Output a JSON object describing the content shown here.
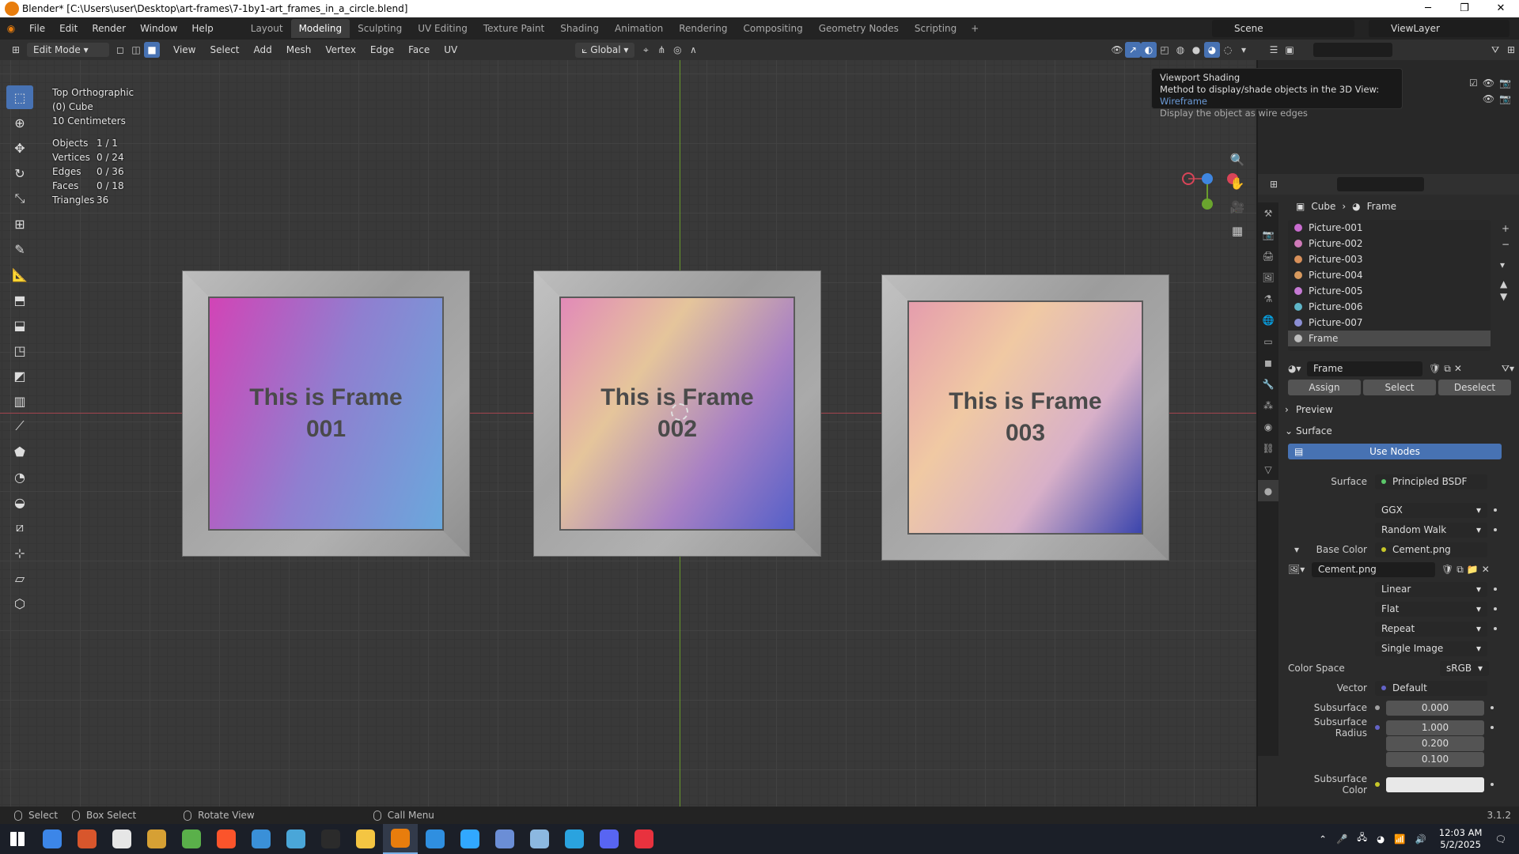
{
  "window": {
    "title": "Blender* [C:\\Users\\user\\Desktop\\art-frames\\7-1by1-art_frames_in_a_circle.blend]"
  },
  "menus": [
    "File",
    "Edit",
    "Render",
    "Window",
    "Help"
  ],
  "workspaces": [
    "Layout",
    "Modeling",
    "Sculpting",
    "UV Editing",
    "Texture Paint",
    "Shading",
    "Animation",
    "Rendering",
    "Compositing",
    "Geometry Nodes",
    "Scripting"
  ],
  "active_workspace": "Modeling",
  "scene": "Scene",
  "view_layer": "ViewLayer",
  "header3d": {
    "mode": "Edit Mode",
    "menus": [
      "View",
      "Select",
      "Add",
      "Mesh",
      "Vertex",
      "Edge",
      "Face",
      "UV"
    ],
    "orientation": "Global"
  },
  "viewport": {
    "view_name": "Top Orthographic",
    "object": "(0) Cube",
    "scale": "10 Centimeters",
    "stats": [
      {
        "k": "Objects",
        "v": "1 / 1"
      },
      {
        "k": "Vertices",
        "v": "0 / 24"
      },
      {
        "k": "Edges",
        "v": "0 / 36"
      },
      {
        "k": "Faces",
        "v": "0 / 18"
      },
      {
        "k": "Triangles",
        "v": "36"
      }
    ],
    "frames": [
      {
        "label": "This is Frame\n001",
        "gradient": [
          "#d244b6",
          "#8f7fd0",
          "#6aa8dc"
        ]
      },
      {
        "label": "This is Frame\n002",
        "gradient": [
          "#e28ab8",
          "#e5c59b",
          "#a880c4",
          "#5560c8"
        ]
      },
      {
        "label": "This is Frame\n003",
        "gradient": [
          "#e59dad",
          "#f0c9a3",
          "#d8b0c8",
          "#3b45ad"
        ]
      }
    ]
  },
  "tooltip": {
    "title": "Viewport Shading",
    "desc_prefix": "Method to display/shade objects in the 3D View:",
    "desc_value": "Wireframe",
    "sub": "Display the object as wire edges"
  },
  "properties": {
    "breadcrumb": {
      "object": "Cube",
      "material": "Frame"
    },
    "materials": [
      {
        "name": "Picture-001",
        "color": "#c96ccf"
      },
      {
        "name": "Picture-002",
        "color": "#cf7ab8"
      },
      {
        "name": "Picture-003",
        "color": "#d8905a"
      },
      {
        "name": "Picture-004",
        "color": "#d89a5e"
      },
      {
        "name": "Picture-005",
        "color": "#c67ad4"
      },
      {
        "name": "Picture-006",
        "color": "#5fb6c8"
      },
      {
        "name": "Picture-007",
        "color": "#8c8fd4"
      },
      {
        "name": "Frame",
        "color": "#bdbdbd"
      }
    ],
    "active_material": "Frame",
    "buttons": {
      "assign": "Assign",
      "select": "Select",
      "deselect": "Deselect"
    },
    "preview": "Preview",
    "surface_section": "Surface",
    "use_nodes": "Use Nodes",
    "surface_label": "Surface",
    "surface_value": "Principled BSDF",
    "distribution": "GGX",
    "subsurface_method": "Random Walk",
    "base_color_label": "Base Color",
    "base_color_value": "Cement.png",
    "image_name": "Cement.png",
    "interpolation": "Linear",
    "projection": "Flat",
    "extension": "Repeat",
    "source": "Single Image",
    "color_space_label": "Color Space",
    "color_space": "sRGB",
    "vector_label": "Vector",
    "vector_value": "Default",
    "subsurface_label": "Subsurface",
    "subsurface_value": "0.000",
    "subsurface_radius_label": "Subsurface Radius",
    "subsurface_radius": [
      "1.000",
      "0.200",
      "0.100"
    ],
    "subsurface_color_label": "Subsurface Color"
  },
  "statusbar": {
    "select": "Select",
    "box_select": "Box Select",
    "rotate": "Rotate View",
    "call_menu": "Call Menu",
    "version": "3.1.2"
  },
  "taskbar": {
    "apps": [
      {
        "name": "start",
        "color": "#ffffff"
      },
      {
        "name": "app-1",
        "color": "#3c86e8"
      },
      {
        "name": "app-2",
        "color": "#d8562c"
      },
      {
        "name": "app-3",
        "color": "#e6e6e6"
      },
      {
        "name": "app-4",
        "color": "#d6a034"
      },
      {
        "name": "app-5",
        "color": "#5ab04a"
      },
      {
        "name": "brave",
        "color": "#fb542b"
      },
      {
        "name": "app-7",
        "color": "#3a90d8"
      },
      {
        "name": "app-8",
        "color": "#4aa6d8"
      },
      {
        "name": "terminal",
        "color": "#2b2b2b"
      },
      {
        "name": "explorer",
        "color": "#f4c542"
      },
      {
        "name": "blender",
        "color": "#e87d0d"
      },
      {
        "name": "app-12",
        "color": "#2f8fe0"
      },
      {
        "name": "photoshop",
        "color": "#31a8ff"
      },
      {
        "name": "app-14",
        "color": "#6b8ed6"
      },
      {
        "name": "app-15",
        "color": "#8cb8e0"
      },
      {
        "name": "telegram",
        "color": "#2aa3df"
      },
      {
        "name": "discord",
        "color": "#5865f2"
      },
      {
        "name": "app-18",
        "color": "#e8323e"
      }
    ],
    "time": "12:03 AM",
    "date": "5/2/2025"
  }
}
